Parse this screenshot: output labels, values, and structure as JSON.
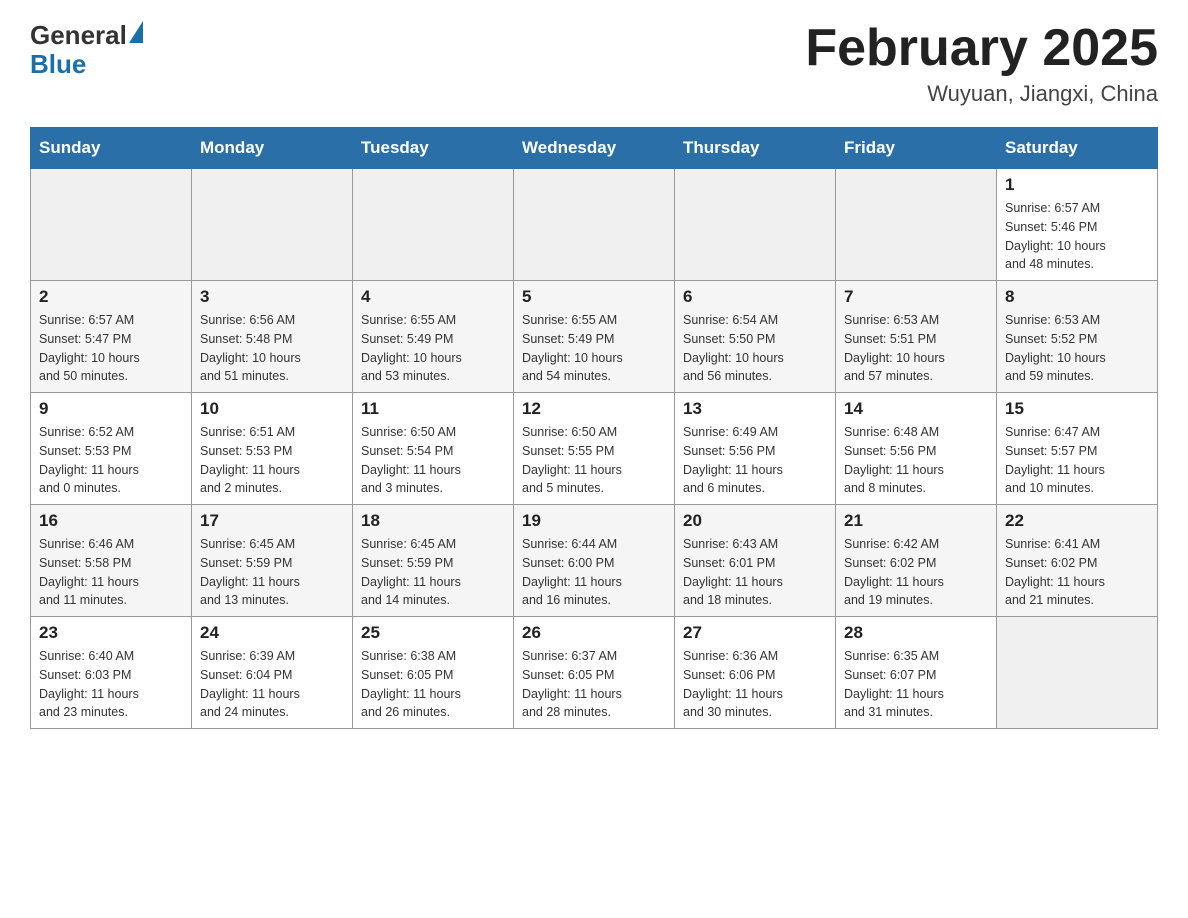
{
  "header": {
    "logo_general": "General",
    "logo_blue": "Blue",
    "month_title": "February 2025",
    "location": "Wuyuan, Jiangxi, China"
  },
  "days_of_week": [
    "Sunday",
    "Monday",
    "Tuesday",
    "Wednesday",
    "Thursday",
    "Friday",
    "Saturday"
  ],
  "weeks": [
    [
      {
        "day": "",
        "info": ""
      },
      {
        "day": "",
        "info": ""
      },
      {
        "day": "",
        "info": ""
      },
      {
        "day": "",
        "info": ""
      },
      {
        "day": "",
        "info": ""
      },
      {
        "day": "",
        "info": ""
      },
      {
        "day": "1",
        "info": "Sunrise: 6:57 AM\nSunset: 5:46 PM\nDaylight: 10 hours\nand 48 minutes."
      }
    ],
    [
      {
        "day": "2",
        "info": "Sunrise: 6:57 AM\nSunset: 5:47 PM\nDaylight: 10 hours\nand 50 minutes."
      },
      {
        "day": "3",
        "info": "Sunrise: 6:56 AM\nSunset: 5:48 PM\nDaylight: 10 hours\nand 51 minutes."
      },
      {
        "day": "4",
        "info": "Sunrise: 6:55 AM\nSunset: 5:49 PM\nDaylight: 10 hours\nand 53 minutes."
      },
      {
        "day": "5",
        "info": "Sunrise: 6:55 AM\nSunset: 5:49 PM\nDaylight: 10 hours\nand 54 minutes."
      },
      {
        "day": "6",
        "info": "Sunrise: 6:54 AM\nSunset: 5:50 PM\nDaylight: 10 hours\nand 56 minutes."
      },
      {
        "day": "7",
        "info": "Sunrise: 6:53 AM\nSunset: 5:51 PM\nDaylight: 10 hours\nand 57 minutes."
      },
      {
        "day": "8",
        "info": "Sunrise: 6:53 AM\nSunset: 5:52 PM\nDaylight: 10 hours\nand 59 minutes."
      }
    ],
    [
      {
        "day": "9",
        "info": "Sunrise: 6:52 AM\nSunset: 5:53 PM\nDaylight: 11 hours\nand 0 minutes."
      },
      {
        "day": "10",
        "info": "Sunrise: 6:51 AM\nSunset: 5:53 PM\nDaylight: 11 hours\nand 2 minutes."
      },
      {
        "day": "11",
        "info": "Sunrise: 6:50 AM\nSunset: 5:54 PM\nDaylight: 11 hours\nand 3 minutes."
      },
      {
        "day": "12",
        "info": "Sunrise: 6:50 AM\nSunset: 5:55 PM\nDaylight: 11 hours\nand 5 minutes."
      },
      {
        "day": "13",
        "info": "Sunrise: 6:49 AM\nSunset: 5:56 PM\nDaylight: 11 hours\nand 6 minutes."
      },
      {
        "day": "14",
        "info": "Sunrise: 6:48 AM\nSunset: 5:56 PM\nDaylight: 11 hours\nand 8 minutes."
      },
      {
        "day": "15",
        "info": "Sunrise: 6:47 AM\nSunset: 5:57 PM\nDaylight: 11 hours\nand 10 minutes."
      }
    ],
    [
      {
        "day": "16",
        "info": "Sunrise: 6:46 AM\nSunset: 5:58 PM\nDaylight: 11 hours\nand 11 minutes."
      },
      {
        "day": "17",
        "info": "Sunrise: 6:45 AM\nSunset: 5:59 PM\nDaylight: 11 hours\nand 13 minutes."
      },
      {
        "day": "18",
        "info": "Sunrise: 6:45 AM\nSunset: 5:59 PM\nDaylight: 11 hours\nand 14 minutes."
      },
      {
        "day": "19",
        "info": "Sunrise: 6:44 AM\nSunset: 6:00 PM\nDaylight: 11 hours\nand 16 minutes."
      },
      {
        "day": "20",
        "info": "Sunrise: 6:43 AM\nSunset: 6:01 PM\nDaylight: 11 hours\nand 18 minutes."
      },
      {
        "day": "21",
        "info": "Sunrise: 6:42 AM\nSunset: 6:02 PM\nDaylight: 11 hours\nand 19 minutes."
      },
      {
        "day": "22",
        "info": "Sunrise: 6:41 AM\nSunset: 6:02 PM\nDaylight: 11 hours\nand 21 minutes."
      }
    ],
    [
      {
        "day": "23",
        "info": "Sunrise: 6:40 AM\nSunset: 6:03 PM\nDaylight: 11 hours\nand 23 minutes."
      },
      {
        "day": "24",
        "info": "Sunrise: 6:39 AM\nSunset: 6:04 PM\nDaylight: 11 hours\nand 24 minutes."
      },
      {
        "day": "25",
        "info": "Sunrise: 6:38 AM\nSunset: 6:05 PM\nDaylight: 11 hours\nand 26 minutes."
      },
      {
        "day": "26",
        "info": "Sunrise: 6:37 AM\nSunset: 6:05 PM\nDaylight: 11 hours\nand 28 minutes."
      },
      {
        "day": "27",
        "info": "Sunrise: 6:36 AM\nSunset: 6:06 PM\nDaylight: 11 hours\nand 30 minutes."
      },
      {
        "day": "28",
        "info": "Sunrise: 6:35 AM\nSunset: 6:07 PM\nDaylight: 11 hours\nand 31 minutes."
      },
      {
        "day": "",
        "info": ""
      }
    ]
  ]
}
